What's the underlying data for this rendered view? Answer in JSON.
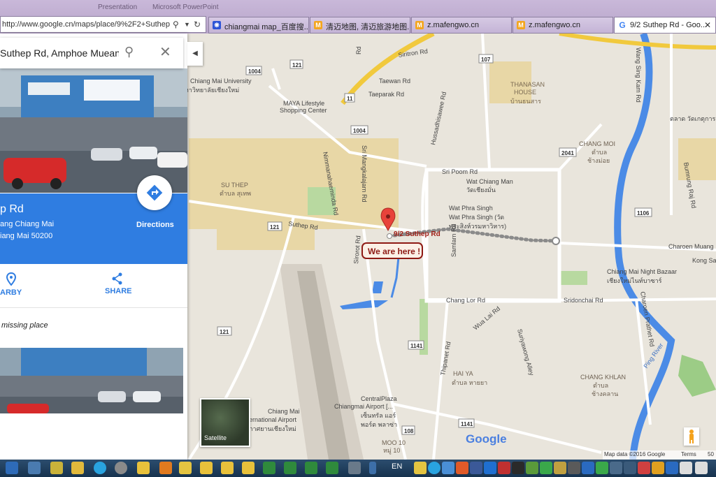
{
  "browser": {
    "top_left_text": "Presentation",
    "top_mid_text": "Microsoft PowerPoint",
    "url": "http://www.google.cn/maps/place/9%2F2+Suthep+R",
    "tabs": [
      {
        "label": "chiangmai map_百度搜...",
        "favicon": "baidu"
      },
      {
        "label": "清迈地图, 清迈旅游地图...",
        "favicon": "mafengwo"
      },
      {
        "label": "z.mafengwo.cn",
        "favicon": "mafengwo"
      },
      {
        "label": "z.mafengwo.cn",
        "favicon": "mafengwo"
      },
      {
        "label": "9/2 Suthep Rd - Goo...",
        "favicon": "google",
        "active": true
      }
    ]
  },
  "search": {
    "query": "Suthep Rd, Amphoe Mueang"
  },
  "place": {
    "name": "p Rd",
    "address_line1": "ang Chiang Mai",
    "address_line2": "iang Mai 50200",
    "directions_label": "Directions",
    "actions": [
      {
        "label": "ARBY",
        "icon": "location-icon"
      },
      {
        "label": "SHARE",
        "icon": "share-icon"
      }
    ],
    "missing_place": "missing place"
  },
  "map": {
    "marker_label": "9/2 Suthep Rd",
    "callout": "We are here !",
    "satellite_label": "Satellite",
    "google_logo": "Google",
    "attribution": "Map data ©2016 Google",
    "terms": "Terms",
    "scale": "50",
    "labels": [
      {
        "text": "Chiang Mai University",
        "cls": "poi"
      },
      {
        "text": "มหาวิทยาลัยเชียงใหม่",
        "cls": "poi"
      },
      {
        "text": "MAYA Lifestyle",
        "cls": "poi"
      },
      {
        "text": "Shopping Center",
        "cls": "poi"
      },
      {
        "text": "THANASAN",
        "cls": "area"
      },
      {
        "text": "HOUSE",
        "cls": "area"
      },
      {
        "text": "บ้านธนสาร",
        "cls": "area"
      },
      {
        "text": "SU THEP",
        "cls": "district"
      },
      {
        "text": "ตำบล สุเทพ",
        "cls": "district"
      },
      {
        "text": "CHANG MOI",
        "cls": "district"
      },
      {
        "text": "ตำบล",
        "cls": "district"
      },
      {
        "text": "ช้างม่อย",
        "cls": "district"
      },
      {
        "text": "Wat Chiang Man",
        "cls": "poi"
      },
      {
        "text": "วัดเชียงมั่น",
        "cls": "poi"
      },
      {
        "text": "Wat Phra Singh",
        "cls": "poi"
      },
      {
        "text": "Wat Phra Singh (วัด",
        "cls": "poi"
      },
      {
        "text": "พระสิงห์วรมหาวิหาร)",
        "cls": "poi"
      },
      {
        "text": "Chiang Mai Night Bazaar",
        "cls": "poi"
      },
      {
        "text": "เชียงใหม่ไนท์บาซาร์",
        "cls": "poi"
      },
      {
        "text": "HAI YA",
        "cls": "district"
      },
      {
        "text": "ตำบล หายยา",
        "cls": "district"
      },
      {
        "text": "CHANG KHLAN",
        "cls": "district"
      },
      {
        "text": "ตำบล",
        "cls": "district"
      },
      {
        "text": "ช้างคลาน",
        "cls": "district"
      },
      {
        "text": "CentralPlaza",
        "cls": "poi"
      },
      {
        "text": "Chiangmai Airport [...",
        "cls": "poi"
      },
      {
        "text": "เซ็นทรัล แอร์",
        "cls": "poi"
      },
      {
        "text": "พอร์ต พลาซ่า",
        "cls": "poi"
      },
      {
        "text": "Chiang Mai",
        "cls": "poi"
      },
      {
        "text": "ernational Airport",
        "cls": "poi"
      },
      {
        "text": "กาศยานเชียงใหม่",
        "cls": "poi"
      },
      {
        "text": "MOO 10",
        "cls": "district"
      },
      {
        "text": "หมู่ 10",
        "cls": "district"
      },
      {
        "text": "Sri Poom Rd",
        "cls": "road"
      },
      {
        "text": "Suthep Rd",
        "cls": "road"
      },
      {
        "text": "Chang Lor Rd",
        "cls": "road"
      },
      {
        "text": "Sridonchai Rd",
        "cls": "road"
      },
      {
        "text": "Charoen Muang",
        "cls": "road"
      },
      {
        "text": "Kong Sai",
        "cls": "road"
      },
      {
        "text": "Siritron Rd",
        "cls": "road"
      },
      {
        "text": "Taewan Rd",
        "cls": "road"
      },
      {
        "text": "Taeparak Rd",
        "cls": "road"
      },
      {
        "text": "Nimmanahaeminda Rd",
        "cls": "road"
      },
      {
        "text": "Sri Mangkalajarn Rd",
        "cls": "road"
      },
      {
        "text": "Hussadhisawee Rd",
        "cls": "road"
      },
      {
        "text": "Samlarn Rd",
        "cls": "road"
      },
      {
        "text": "Sirorot Rd",
        "cls": "road"
      },
      {
        "text": "Wua Lai Rd",
        "cls": "road"
      },
      {
        "text": "Suriyawong Alley",
        "cls": "road"
      },
      {
        "text": "Thipanet Rd",
        "cls": "road"
      },
      {
        "text": "Wang Sing Kam Rd",
        "cls": "road"
      },
      {
        "text": "Bumrung Raj Rd",
        "cls": "road"
      },
      {
        "text": "Charoen Prathet Rd",
        "cls": "road"
      },
      {
        "text": "Ping River",
        "cls": "river"
      },
      {
        "text": "Rd",
        "cls": "road"
      },
      {
        "text": "ตลาด วัดเกตุการ",
        "cls": "poi"
      }
    ],
    "shields": [
      "1004",
      "121",
      "11",
      "1004",
      "107",
      "121",
      "121",
      "1141",
      "108",
      "1141",
      "2041",
      "1106",
      "108"
    ]
  },
  "taskbar": {
    "lang": "EN"
  }
}
